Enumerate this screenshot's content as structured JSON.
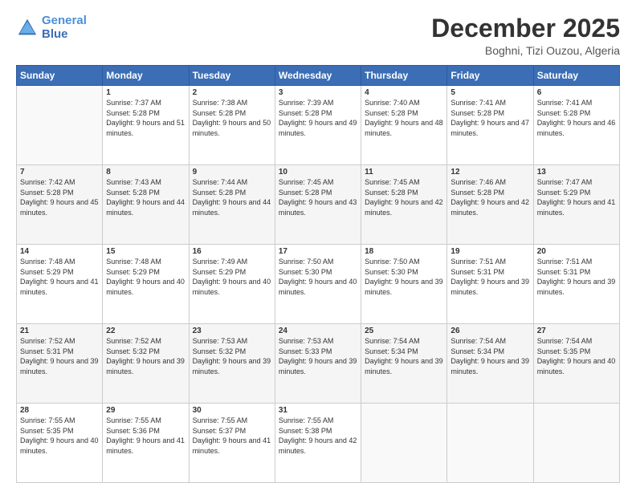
{
  "logo": {
    "line1": "General",
    "line2": "Blue"
  },
  "header": {
    "month": "December 2025",
    "location": "Boghni, Tizi Ouzou, Algeria"
  },
  "days_of_week": [
    "Sunday",
    "Monday",
    "Tuesday",
    "Wednesday",
    "Thursday",
    "Friday",
    "Saturday"
  ],
  "weeks": [
    [
      {
        "day": "",
        "sunrise": "",
        "sunset": "",
        "daylight": ""
      },
      {
        "day": "1",
        "sunrise": "Sunrise: 7:37 AM",
        "sunset": "Sunset: 5:28 PM",
        "daylight": "Daylight: 9 hours and 51 minutes."
      },
      {
        "day": "2",
        "sunrise": "Sunrise: 7:38 AM",
        "sunset": "Sunset: 5:28 PM",
        "daylight": "Daylight: 9 hours and 50 minutes."
      },
      {
        "day": "3",
        "sunrise": "Sunrise: 7:39 AM",
        "sunset": "Sunset: 5:28 PM",
        "daylight": "Daylight: 9 hours and 49 minutes."
      },
      {
        "day": "4",
        "sunrise": "Sunrise: 7:40 AM",
        "sunset": "Sunset: 5:28 PM",
        "daylight": "Daylight: 9 hours and 48 minutes."
      },
      {
        "day": "5",
        "sunrise": "Sunrise: 7:41 AM",
        "sunset": "Sunset: 5:28 PM",
        "daylight": "Daylight: 9 hours and 47 minutes."
      },
      {
        "day": "6",
        "sunrise": "Sunrise: 7:41 AM",
        "sunset": "Sunset: 5:28 PM",
        "daylight": "Daylight: 9 hours and 46 minutes."
      }
    ],
    [
      {
        "day": "7",
        "sunrise": "Sunrise: 7:42 AM",
        "sunset": "Sunset: 5:28 PM",
        "daylight": "Daylight: 9 hours and 45 minutes."
      },
      {
        "day": "8",
        "sunrise": "Sunrise: 7:43 AM",
        "sunset": "Sunset: 5:28 PM",
        "daylight": "Daylight: 9 hours and 44 minutes."
      },
      {
        "day": "9",
        "sunrise": "Sunrise: 7:44 AM",
        "sunset": "Sunset: 5:28 PM",
        "daylight": "Daylight: 9 hours and 44 minutes."
      },
      {
        "day": "10",
        "sunrise": "Sunrise: 7:45 AM",
        "sunset": "Sunset: 5:28 PM",
        "daylight": "Daylight: 9 hours and 43 minutes."
      },
      {
        "day": "11",
        "sunrise": "Sunrise: 7:45 AM",
        "sunset": "Sunset: 5:28 PM",
        "daylight": "Daylight: 9 hours and 42 minutes."
      },
      {
        "day": "12",
        "sunrise": "Sunrise: 7:46 AM",
        "sunset": "Sunset: 5:28 PM",
        "daylight": "Daylight: 9 hours and 42 minutes."
      },
      {
        "day": "13",
        "sunrise": "Sunrise: 7:47 AM",
        "sunset": "Sunset: 5:29 PM",
        "daylight": "Daylight: 9 hours and 41 minutes."
      }
    ],
    [
      {
        "day": "14",
        "sunrise": "Sunrise: 7:48 AM",
        "sunset": "Sunset: 5:29 PM",
        "daylight": "Daylight: 9 hours and 41 minutes."
      },
      {
        "day": "15",
        "sunrise": "Sunrise: 7:48 AM",
        "sunset": "Sunset: 5:29 PM",
        "daylight": "Daylight: 9 hours and 40 minutes."
      },
      {
        "day": "16",
        "sunrise": "Sunrise: 7:49 AM",
        "sunset": "Sunset: 5:29 PM",
        "daylight": "Daylight: 9 hours and 40 minutes."
      },
      {
        "day": "17",
        "sunrise": "Sunrise: 7:50 AM",
        "sunset": "Sunset: 5:30 PM",
        "daylight": "Daylight: 9 hours and 40 minutes."
      },
      {
        "day": "18",
        "sunrise": "Sunrise: 7:50 AM",
        "sunset": "Sunset: 5:30 PM",
        "daylight": "Daylight: 9 hours and 39 minutes."
      },
      {
        "day": "19",
        "sunrise": "Sunrise: 7:51 AM",
        "sunset": "Sunset: 5:31 PM",
        "daylight": "Daylight: 9 hours and 39 minutes."
      },
      {
        "day": "20",
        "sunrise": "Sunrise: 7:51 AM",
        "sunset": "Sunset: 5:31 PM",
        "daylight": "Daylight: 9 hours and 39 minutes."
      }
    ],
    [
      {
        "day": "21",
        "sunrise": "Sunrise: 7:52 AM",
        "sunset": "Sunset: 5:31 PM",
        "daylight": "Daylight: 9 hours and 39 minutes."
      },
      {
        "day": "22",
        "sunrise": "Sunrise: 7:52 AM",
        "sunset": "Sunset: 5:32 PM",
        "daylight": "Daylight: 9 hours and 39 minutes."
      },
      {
        "day": "23",
        "sunrise": "Sunrise: 7:53 AM",
        "sunset": "Sunset: 5:32 PM",
        "daylight": "Daylight: 9 hours and 39 minutes."
      },
      {
        "day": "24",
        "sunrise": "Sunrise: 7:53 AM",
        "sunset": "Sunset: 5:33 PM",
        "daylight": "Daylight: 9 hours and 39 minutes."
      },
      {
        "day": "25",
        "sunrise": "Sunrise: 7:54 AM",
        "sunset": "Sunset: 5:34 PM",
        "daylight": "Daylight: 9 hours and 39 minutes."
      },
      {
        "day": "26",
        "sunrise": "Sunrise: 7:54 AM",
        "sunset": "Sunset: 5:34 PM",
        "daylight": "Daylight: 9 hours and 39 minutes."
      },
      {
        "day": "27",
        "sunrise": "Sunrise: 7:54 AM",
        "sunset": "Sunset: 5:35 PM",
        "daylight": "Daylight: 9 hours and 40 minutes."
      }
    ],
    [
      {
        "day": "28",
        "sunrise": "Sunrise: 7:55 AM",
        "sunset": "Sunset: 5:35 PM",
        "daylight": "Daylight: 9 hours and 40 minutes."
      },
      {
        "day": "29",
        "sunrise": "Sunrise: 7:55 AM",
        "sunset": "Sunset: 5:36 PM",
        "daylight": "Daylight: 9 hours and 41 minutes."
      },
      {
        "day": "30",
        "sunrise": "Sunrise: 7:55 AM",
        "sunset": "Sunset: 5:37 PM",
        "daylight": "Daylight: 9 hours and 41 minutes."
      },
      {
        "day": "31",
        "sunrise": "Sunrise: 7:55 AM",
        "sunset": "Sunset: 5:38 PM",
        "daylight": "Daylight: 9 hours and 42 minutes."
      },
      {
        "day": "",
        "sunrise": "",
        "sunset": "",
        "daylight": ""
      },
      {
        "day": "",
        "sunrise": "",
        "sunset": "",
        "daylight": ""
      },
      {
        "day": "",
        "sunrise": "",
        "sunset": "",
        "daylight": ""
      }
    ]
  ]
}
